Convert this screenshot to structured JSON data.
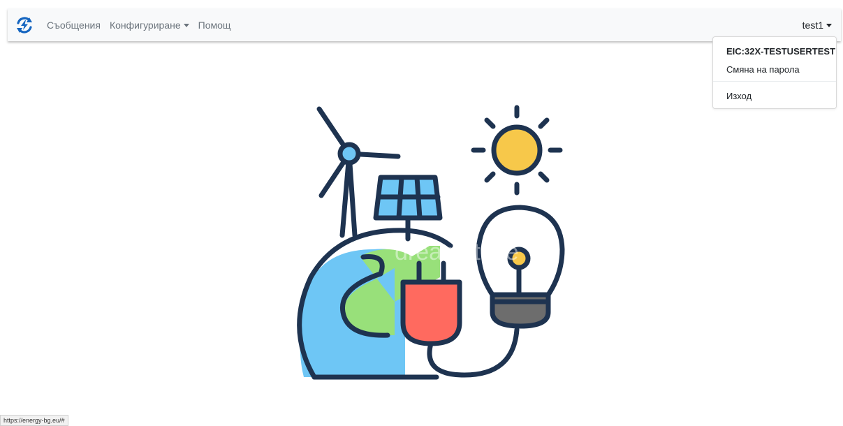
{
  "navbar": {
    "brand_icon": "sync-bolt-icon",
    "brand_color": "#1565c0",
    "links": [
      {
        "label": "Съобщения"
      },
      {
        "label": "Конфигуриране"
      },
      {
        "label": "Помощ"
      }
    ],
    "user": "test1"
  },
  "user_menu": {
    "header": "EIC:32X-TESTUSERTEST",
    "change_password": "Смяна на парола",
    "logout": "Изход"
  },
  "hero": {
    "illustration": "renewable-energy-illustration",
    "watermark": "dreamstime"
  },
  "status_bar": {
    "url": "https://energy-bg.eu/#"
  }
}
